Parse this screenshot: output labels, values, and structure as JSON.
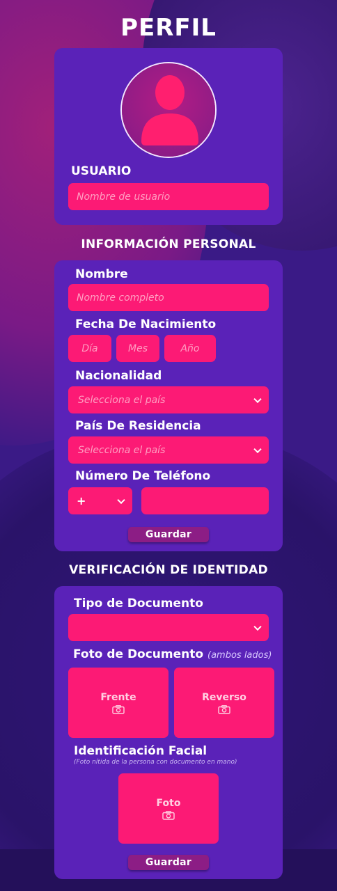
{
  "title": "PERFIL",
  "usuario": {
    "label": "USUARIO",
    "placeholder": "Nombre de usuario"
  },
  "personal": {
    "heading": "INFORMACIÓN PERSONAL",
    "nombre_label": "Nombre",
    "nombre_placeholder": "Nombre completo",
    "fecha_label": "Fecha De Nacimiento",
    "dia": "Día",
    "mes": "Mes",
    "anio": "Año",
    "nacionalidad_label": "Nacionalidad",
    "nacionalidad_placeholder": "Selecciona el país",
    "residencia_label": "País De Residencia",
    "residencia_placeholder": "Selecciona el país",
    "telefono_label": "Número De Teléfono",
    "telefono_prefix": "+",
    "save": "Guardar"
  },
  "verificacion": {
    "heading": "VERIFICACIÓN DE IDENTIDAD",
    "tipo_label": "Tipo de Documento",
    "foto_label": "Foto de Documento",
    "foto_hint": "(ambos lados)",
    "frente": "Frente",
    "reverso": "Reverso",
    "facial_label": "Identificación Facial",
    "facial_hint": "(Foto nítida de la persona con documento en mano)",
    "foto": "Foto",
    "save": "Guardar"
  },
  "colors": {
    "field": "#fc1a75",
    "card": "#5a22b8",
    "button": "#8c1d85",
    "avatar_figure": "#ff1f6f"
  },
  "icons": [
    "user-avatar-icon",
    "chevron-down-icon",
    "camera-icon"
  ]
}
